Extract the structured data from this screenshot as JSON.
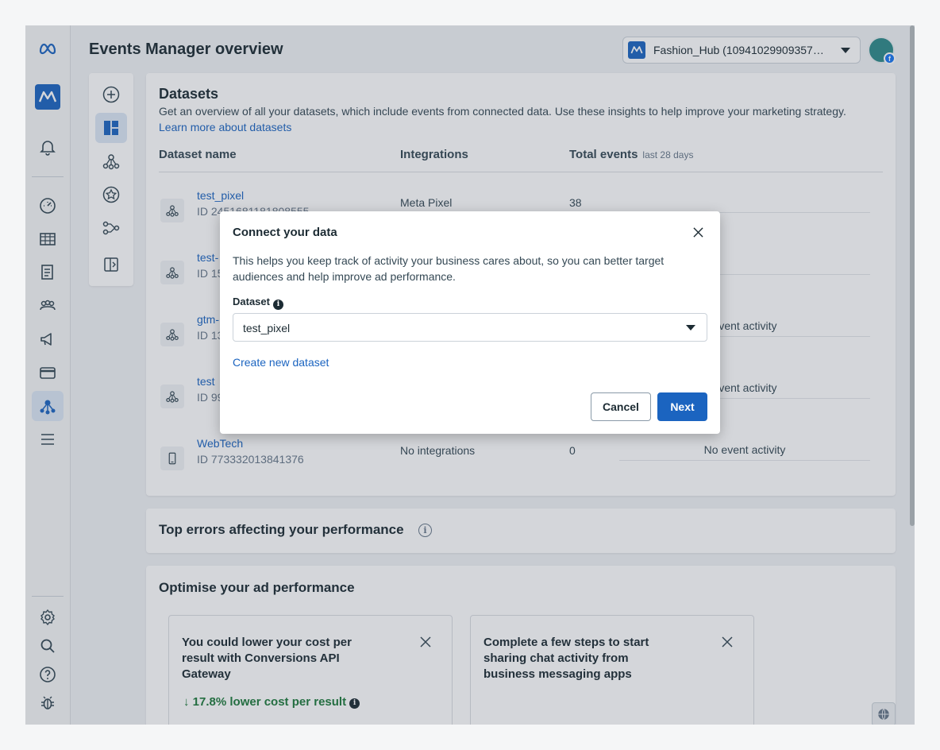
{
  "header": {
    "title": "Events Manager overview",
    "account_name": "Fashion_Hub (10941029909357…",
    "avatar_badge": "f"
  },
  "rail": {
    "icons": [
      "meta-logo-icon",
      "app-tile-icon",
      "bell-icon",
      "dashboard-icon",
      "table-icon",
      "document-icon",
      "audience-icon",
      "megaphone-icon",
      "billing-card-icon",
      "events-manager-icon",
      "menu-icon",
      "settings-icon",
      "search-icon",
      "help-icon",
      "bug-icon"
    ],
    "active": "events-manager-icon"
  },
  "tools": {
    "icons": [
      "add-icon",
      "overview-icon",
      "datasets-icon",
      "custom-conversions-icon",
      "partner-integrations-icon",
      "signals-icon"
    ],
    "active": "overview-icon"
  },
  "datasets": {
    "title": "Datasets",
    "description": "Get an overview of all your datasets, which include events from connected data. Use these insights to help improve your marketing strategy.",
    "learn_more": "Learn more about datasets",
    "col_name": "Dataset name",
    "col_integrations": "Integrations",
    "col_total": "Total events",
    "col_total_sub": "last 28 days",
    "rows": [
      {
        "name": "test_pixel",
        "id": "ID 2451681181808555",
        "integrations": "Meta Pixel",
        "total": "38",
        "activity": ""
      },
      {
        "name": "test-",
        "id": "ID 15",
        "integrations": "",
        "total": "",
        "activity": ""
      },
      {
        "name": "gtm-",
        "id": "ID 13",
        "integrations": "",
        "total": "",
        "activity": "event activity"
      },
      {
        "name": "test",
        "id": "ID 99",
        "integrations": "",
        "total": "",
        "activity": "event activity"
      },
      {
        "name": "WebTech",
        "id": "ID 773332013841376",
        "integrations": "No integrations",
        "total": "0",
        "activity": "No event activity"
      }
    ]
  },
  "errors": {
    "title": "Top errors affecting your performance",
    "info_glyph": "i"
  },
  "optimise": {
    "title": "Optimise your ad performance",
    "tiles": [
      {
        "text": "You could lower your cost per result with Conversions API Gateway",
        "metric": "↓ 17.8% lower cost per result"
      },
      {
        "text": "Complete a few steps to start sharing chat activity from business messaging apps",
        "metric": ""
      }
    ]
  },
  "dialog": {
    "title": "Connect your data",
    "description": "This helps you keep track of activity your business cares about, so you can better target audiences and help improve ad performance.",
    "dataset_label": "Dataset",
    "dataset_value": "test_pixel",
    "create_link": "Create new dataset",
    "cancel_label": "Cancel",
    "next_label": "Next"
  },
  "colors": {
    "accent": "#1b64c0",
    "positive": "#1e7a3c",
    "text": "#1c2b33"
  }
}
